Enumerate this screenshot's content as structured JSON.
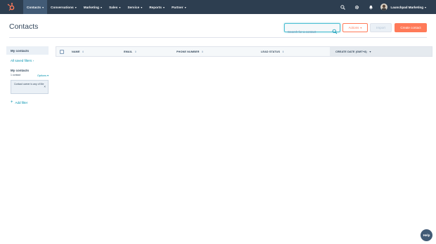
{
  "nav": {
    "items": [
      {
        "label": "Contacts"
      },
      {
        "label": "Conversations"
      },
      {
        "label": "Marketing"
      },
      {
        "label": "Sales"
      },
      {
        "label": "Service"
      },
      {
        "label": "Reports"
      },
      {
        "label": "Partner"
      }
    ],
    "account_name": "Launchpad Marketing"
  },
  "header": {
    "title": "Contacts",
    "search_placeholder": "Search for a contact",
    "actions_label": "Actions",
    "import_label": "Import",
    "create_label": "Create contact"
  },
  "sidebar": {
    "active_view": "My contacts",
    "all_saved_filters": "All saved filters",
    "section_title": "My contacts",
    "count": "1 contact",
    "options_label": "Options",
    "filter_text": "Contact owner is any of Me",
    "add_filter": "Add filter"
  },
  "table": {
    "columns": [
      {
        "label": "NAME"
      },
      {
        "label": "EMAIL"
      },
      {
        "label": "PHONE NUMBER"
      },
      {
        "label": "LEAD STATUS"
      },
      {
        "label": "CREATE DATE (GMT+8)"
      }
    ]
  },
  "help_label": "Help",
  "colors": {
    "nav_bg": "#2d3e50",
    "accent": "#ff7a59",
    "link": "#0091ae"
  }
}
